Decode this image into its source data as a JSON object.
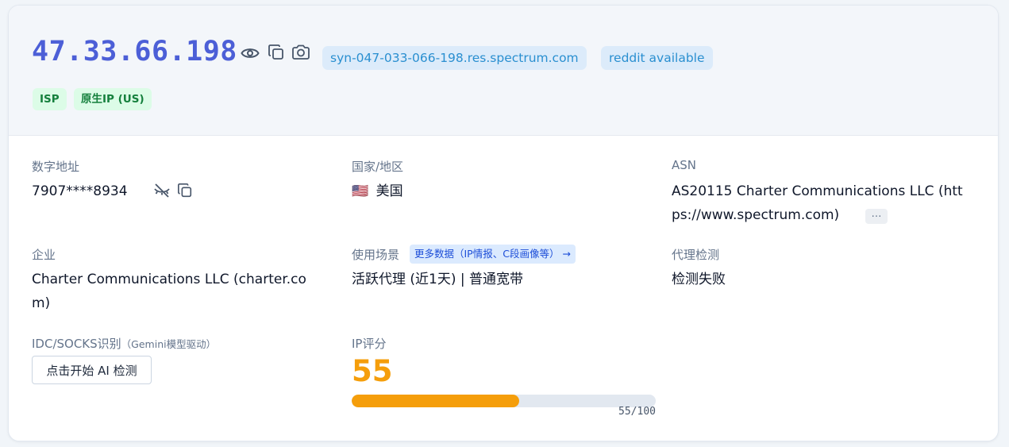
{
  "header": {
    "ip": "47.33.66.198",
    "hostname": "syn-047-033-066-198.res.spectrum.com",
    "reddit_status": "reddit available",
    "tags": [
      "ISP",
      "原生IP (US)"
    ]
  },
  "fields": {
    "numeric_address": {
      "label": "数字地址",
      "value": "7907****8934"
    },
    "country": {
      "label": "国家/地区",
      "flag": "🇺🇸",
      "value": "美国"
    },
    "asn": {
      "label": "ASN",
      "value_line1": "AS20115 Charter Communications LLC (htt",
      "value_line2": "ps://www.spectrum.com)",
      "more": "…"
    },
    "company": {
      "label": "企业",
      "value_line1": "Charter Communications LLC (charter.co",
      "value_line2": "m)"
    },
    "usage": {
      "label": "使用场景",
      "more_link": "更多数据（IP情报、C段画像等） →",
      "value": "活跃代理 (近1天) | 普通宽带"
    },
    "proxy": {
      "label": "代理检测",
      "value": "检测失败"
    },
    "idc": {
      "label": "IDC/SOCKS识别",
      "note": "（Gemini模型驱动）",
      "button": "点击开始 AI 检测"
    },
    "ip_score": {
      "label": "IP评分",
      "score": "55",
      "score_text": "55/100",
      "score_value": 55,
      "score_max": 100
    }
  },
  "colors": {
    "ip": "#4c5fd7",
    "score": "#f59e0b",
    "tag_text": "#15803d",
    "pill_text": "#2a8fd0"
  }
}
